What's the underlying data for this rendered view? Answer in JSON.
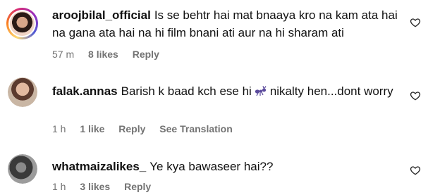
{
  "comments": [
    {
      "username": "aroojbilal_official",
      "text": "Is se behtr hai mat bnaaya kro na kam ata hai na gana ata hai na hi film bnani ati aur na hi sharam ati",
      "time": "57 m",
      "likes": "8 likes",
      "reply": "Reply",
      "avatar_ring": true
    },
    {
      "username": "falak.annas",
      "text_before": "Barish k baad kch ese hi",
      "emoji": "ant-emoji",
      "text_after": "nikalty hen...dont worry",
      "time": "1 h",
      "likes": "1 like",
      "reply": "Reply",
      "translate": "See Translation",
      "avatar_ring": false
    },
    {
      "username": "whatmaizalikes_",
      "text": "Ye kya bawaseer hai??",
      "time": "1 h",
      "likes": "3 likes",
      "reply": "Reply",
      "avatar_ring": false
    }
  ],
  "icons": {
    "like": "heart-outline-icon"
  },
  "colors": {
    "meta_text": "#737373",
    "text": "#111111"
  }
}
